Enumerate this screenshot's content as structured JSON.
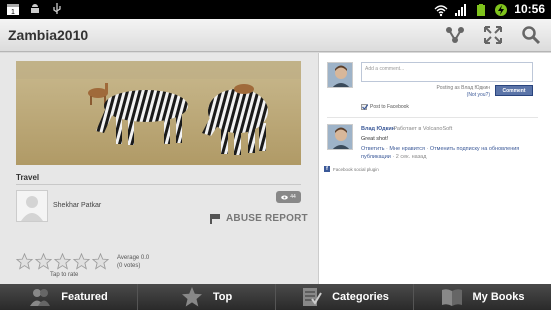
{
  "status_bar": {
    "time": "10:56",
    "left_icons": [
      "calendar-icon",
      "android-icon",
      "usb-icon"
    ],
    "right_icons": [
      "wifi-icon",
      "signal-icon",
      "battery-icon",
      "charging-icon"
    ]
  },
  "action_bar": {
    "title": "Zambia2010",
    "actions": [
      "share-icon",
      "fullscreen-icon",
      "search-icon"
    ]
  },
  "photo": {
    "category": "Travel",
    "author": "Shekhar  Patkar",
    "views_count": "44",
    "abuse_label": "ABUSE REPORT"
  },
  "rating": {
    "average": "Average 0.0",
    "votes": "(0 votes)",
    "tap": "Tap to rate",
    "stars": 0,
    "max": 5
  },
  "facebook": {
    "comment_placeholder": "Add a comment...",
    "posting_as": "Posting as Влад Юдкин",
    "not_you": "(Not you?)",
    "comment_button": "Comment",
    "post_to_facebook": "Post to Facebook",
    "comment": {
      "author": "Влад Юдкин",
      "work": "· Работает в VolcanoSoft",
      "text": "Great shot!",
      "reply": "Ответить",
      "like": "Мне нравится",
      "unsubscribe": "Отменить подписку на обновления публикации",
      "time": "2 сек. назад"
    },
    "plugin": "Facebook social plugin"
  },
  "tabs": [
    {
      "label": "Featured",
      "icon": "people-icon"
    },
    {
      "label": "Top",
      "icon": "star-icon"
    },
    {
      "label": "Categories",
      "icon": "checklist-icon"
    },
    {
      "label": "My Books",
      "icon": "book-icon"
    }
  ],
  "colors": {
    "facebook_blue": "#3b5998",
    "tab_bg": "#3a3a3a",
    "accent_charge": "#7fc31c"
  }
}
